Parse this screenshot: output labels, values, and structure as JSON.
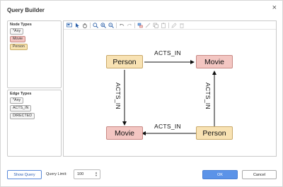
{
  "dialog": {
    "title": "Query Builder",
    "close": "×"
  },
  "node_types": {
    "header": "Node Types",
    "items": [
      {
        "label": "*Any",
        "kind": "any"
      },
      {
        "label": "Movie",
        "kind": "movie"
      },
      {
        "label": "Person",
        "kind": "person"
      }
    ]
  },
  "edge_types": {
    "header": "Edge Types",
    "items": [
      {
        "label": "*Any"
      },
      {
        "label": "ACTS_IN"
      },
      {
        "label": "DIRECTED"
      }
    ]
  },
  "toolbar": {
    "icons": [
      "layout-icon",
      "pointer-icon",
      "pan-hand-icon",
      "zoom-fit-icon",
      "zoom-in-icon",
      "zoom-out-icon",
      "undo-icon",
      "redo-icon",
      "add-node-icon",
      "connect-icon",
      "copy-icon",
      "paste-icon",
      "edit-icon",
      "delete-icon"
    ]
  },
  "graph": {
    "nodes": [
      {
        "label": "Person",
        "type": "Person"
      },
      {
        "label": "Movie",
        "type": "Movie"
      },
      {
        "label": "Movie",
        "type": "Movie"
      },
      {
        "label": "Person",
        "type": "Person"
      }
    ],
    "edges": [
      {
        "label": "ACTS_IN",
        "from": 0,
        "to": 1
      },
      {
        "label": "ACTS_IN",
        "from": 0,
        "to": 2
      },
      {
        "label": "ACTS_IN",
        "from": 3,
        "to": 1
      },
      {
        "label": "ACTS_IN",
        "from": 3,
        "to": 2
      }
    ]
  },
  "footer": {
    "show_query": "Show Query",
    "query_limit_label": "Query Limit:",
    "query_limit_value": "100",
    "ok": "OK",
    "cancel": "Cancel"
  },
  "colors": {
    "person": "#f8e2b3",
    "movie": "#f3c6c2",
    "primary": "#5b93e8"
  }
}
